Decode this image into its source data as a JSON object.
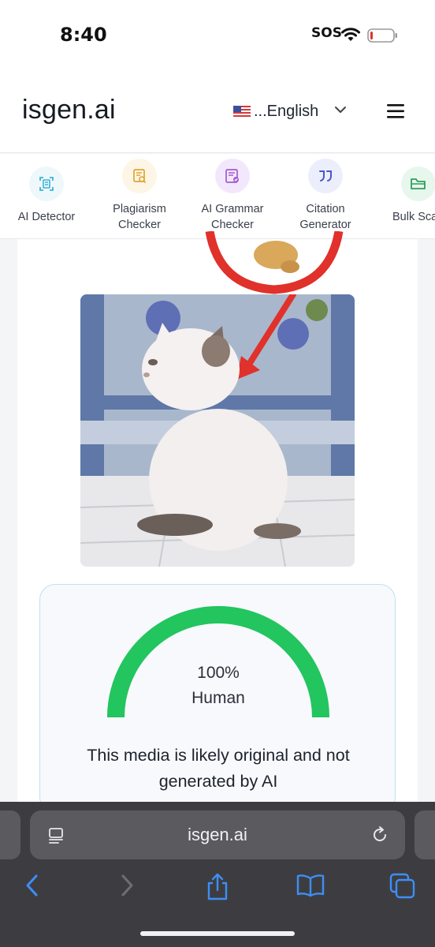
{
  "status_bar": {
    "time": "8:40",
    "sos": "SOS"
  },
  "header": {
    "logo": "isgen.ai",
    "language": "...English"
  },
  "tools": [
    {
      "label_line1": "AI Detector",
      "label_line2": ""
    },
    {
      "label_line1": "Plagiarism",
      "label_line2": "Checker"
    },
    {
      "label_line1": "AI Grammar",
      "label_line2": "Checker"
    },
    {
      "label_line1": "Citation",
      "label_line2": "Generator"
    },
    {
      "label_line1": "Bulk Sca",
      "label_line2": ""
    }
  ],
  "result": {
    "percent": "100%",
    "label": "Human",
    "gauge_fraction": 1.0,
    "message": "This media is likely original and not generated by AI"
  },
  "browser": {
    "url": "isgen.ai"
  },
  "colors": {
    "gauge_green": "#22c55e",
    "accent_cyan": "#3bb3d6",
    "safari_blue": "#3e8ef7"
  }
}
